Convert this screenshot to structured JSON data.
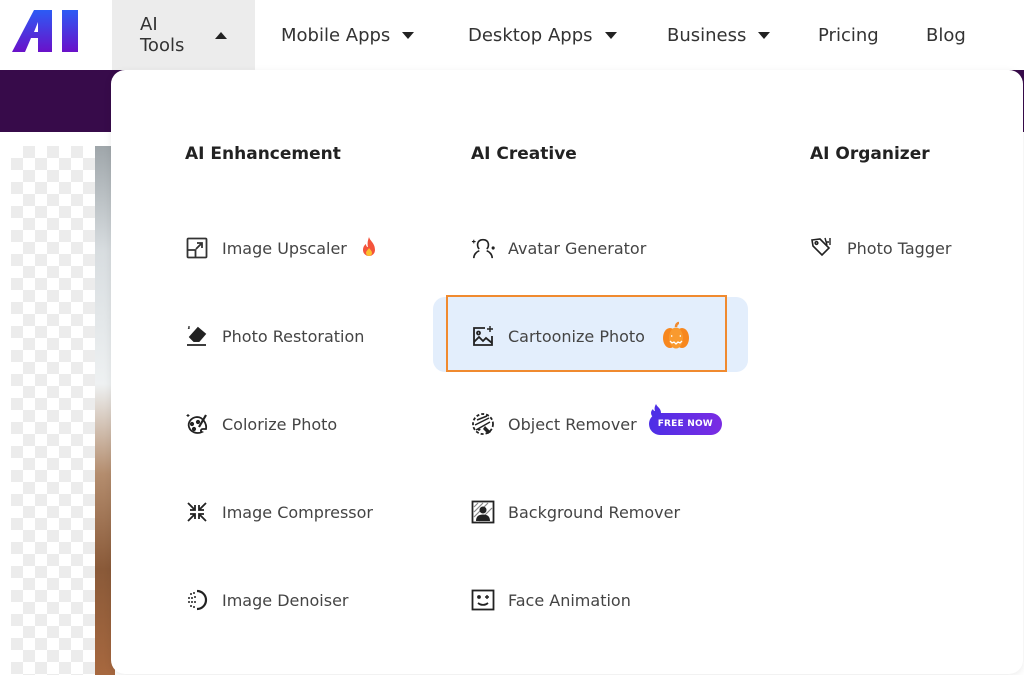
{
  "nav": {
    "logo": "AI",
    "items": [
      {
        "label": "AI Tools",
        "caret": "up",
        "active": true
      },
      {
        "label": "Mobile Apps",
        "caret": "down"
      },
      {
        "label": "Desktop Apps",
        "caret": "down"
      },
      {
        "label": "Business",
        "caret": "down"
      },
      {
        "label": "Pricing"
      },
      {
        "label": "Blog"
      }
    ]
  },
  "dropdown": {
    "columns": [
      {
        "title": "AI Enhancement",
        "items": [
          {
            "label": "Image Upscaler",
            "icon": "upscale-icon",
            "badge": "fire-emoji"
          },
          {
            "label": "Photo Restoration",
            "icon": "eraser-sparkle-icon"
          },
          {
            "label": "Colorize Photo",
            "icon": "palette-icon"
          },
          {
            "label": "Image Compressor",
            "icon": "compress-arrows-icon"
          },
          {
            "label": "Image Denoiser",
            "icon": "denoise-icon"
          }
        ]
      },
      {
        "title": "AI Creative",
        "items": [
          {
            "label": "Avatar Generator",
            "icon": "avatar-sparkle-icon"
          },
          {
            "label": "Cartoonize Photo",
            "icon": "image-sparkle-icon",
            "badge": "pumpkin-emoji",
            "highlighted": true
          },
          {
            "label": "Object Remover",
            "icon": "object-remove-icon",
            "badge_text": "FREE NOW"
          },
          {
            "label": "Background Remover",
            "icon": "person-background-icon"
          },
          {
            "label": "Face Animation",
            "icon": "face-smile-icon"
          }
        ]
      },
      {
        "title": "AI Organizer",
        "items": [
          {
            "label": "Photo Tagger",
            "icon": "tag-ai-icon"
          }
        ]
      }
    ]
  },
  "colors": {
    "highlight_border": "#f08a2f",
    "highlight_bg": "#e3eefc",
    "hero_purple": "#370b4a",
    "badge_gradient_start": "#4d2fe6",
    "badge_gradient_end": "#7a2ce3"
  }
}
